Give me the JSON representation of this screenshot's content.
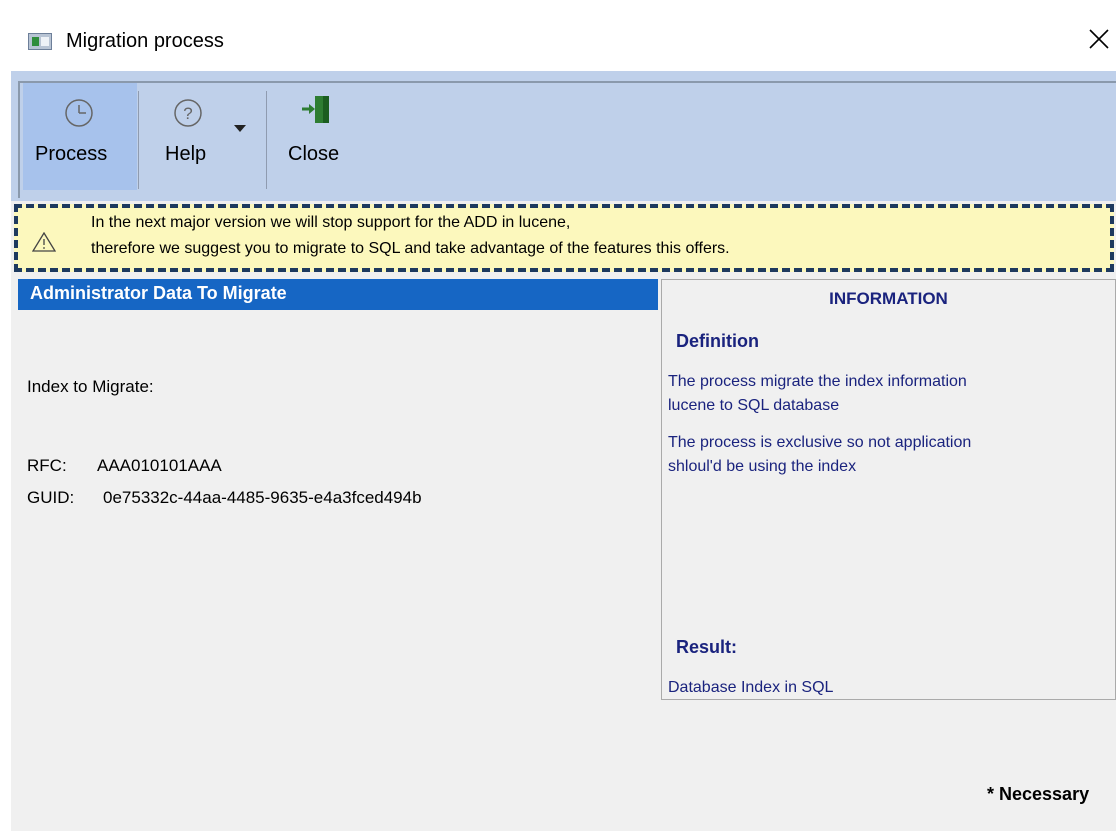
{
  "window": {
    "title": "Migration process"
  },
  "toolbar": {
    "buttons": [
      {
        "label": "Process",
        "icon": "clock-icon"
      },
      {
        "label": "Help",
        "icon": "question-icon"
      },
      {
        "label": "Close",
        "icon": "exit-door-icon"
      }
    ]
  },
  "warning": {
    "icon": "warning-triangle-icon",
    "line1": "In the next major version we will stop support for the ADD in lucene,",
    "line2": "therefore we suggest you to migrate to SQL and take advantage of the features this offers."
  },
  "left": {
    "header": "Administrator Data To Migrate",
    "index_label": "Index to Migrate:",
    "rfc_label": "RFC:",
    "rfc_value": "AAA010101AAA",
    "guid_label": "GUID:",
    "guid_value": "0e75332c-44aa-4485-9635-e4a3fced494b"
  },
  "info": {
    "title": "INFORMATION",
    "definition_heading": "Definition",
    "definition_text_1a": "The process migrate  the index information",
    "definition_text_1b": "lucene to SQL database",
    "definition_text_2a": "The process is exclusive so not application",
    "definition_text_2b": "shloul'd be using the index",
    "result_heading": "Result:",
    "result_text": "Database Index in SQL"
  },
  "footer": {
    "necessary": "* Necessary"
  },
  "colors": {
    "toolbar_bg": "#bfd0ea",
    "active_button_bg": "#a7c2ec",
    "warning_bg": "#fcf8bd",
    "warning_border": "#1e3a5f",
    "header_blue": "#1666c4",
    "info_text": "#1a237e"
  }
}
